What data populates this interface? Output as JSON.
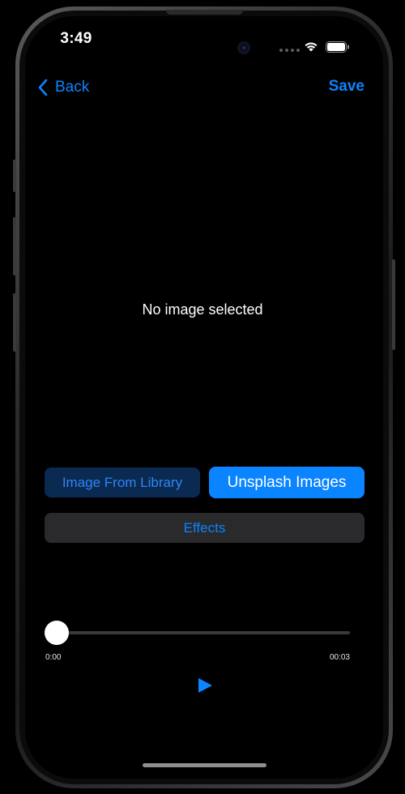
{
  "status_bar": {
    "time": "3:49",
    "wifi_icon": "wifi-icon",
    "battery_icon": "battery-icon"
  },
  "nav": {
    "back_label": "Back",
    "back_icon": "chevron-left-icon",
    "save_label": "Save"
  },
  "main": {
    "placeholder": "No image selected"
  },
  "buttons": {
    "library_label": "Image From Library",
    "unsplash_label": "Unsplash Images",
    "effects_label": "Effects"
  },
  "player": {
    "current_time": "0:00",
    "duration": "00:03",
    "progress": 0,
    "play_icon": "play-icon"
  },
  "colors": {
    "accent": "#0a84ff",
    "background": "#000000"
  }
}
